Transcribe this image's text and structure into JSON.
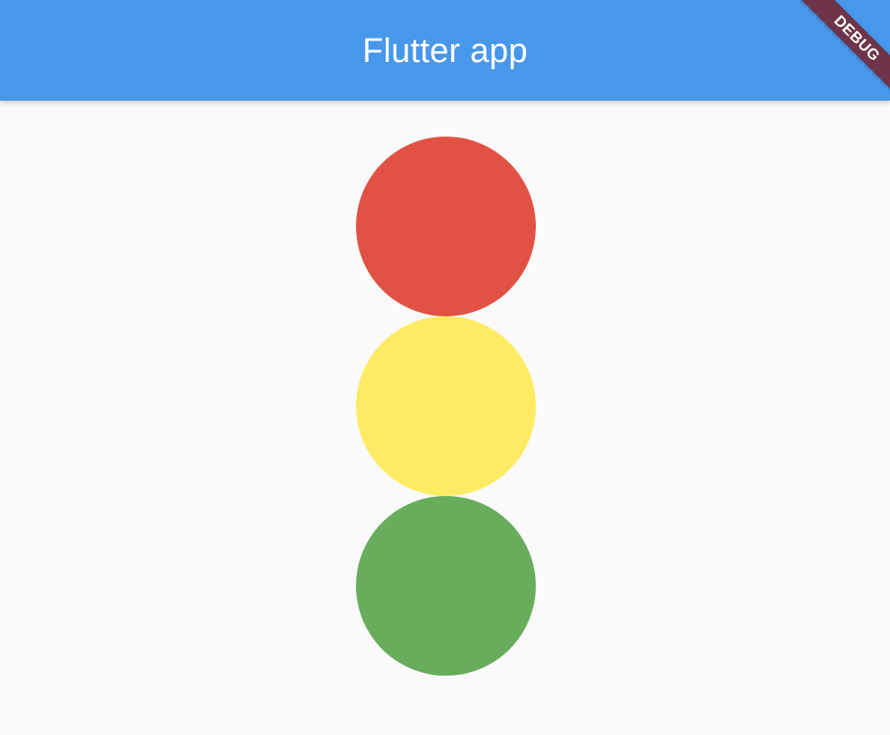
{
  "app_bar": {
    "title": "Flutter app",
    "color": "#4797EA"
  },
  "debug_banner": {
    "label": "DEBUG",
    "color": "#6E3449"
  },
  "background_color": "#FAFAFA",
  "traffic_lights": [
    {
      "name": "red",
      "color": "#E25244"
    },
    {
      "name": "yellow",
      "color": "#FDEB63"
    },
    {
      "name": "green",
      "color": "#67AD5C"
    }
  ]
}
